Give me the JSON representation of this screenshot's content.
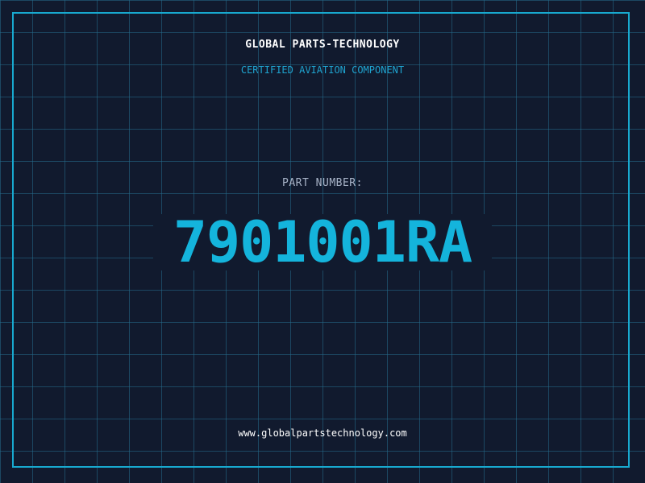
{
  "header": {
    "brand": "GLOBAL PARTS-TECHNOLOGY",
    "tagline": "CERTIFIED AVIATION COMPONENT"
  },
  "main": {
    "label": "PART NUMBER:",
    "part_number": "7901001RA"
  },
  "footer": {
    "url": "www.globalpartstechnology.com"
  },
  "colors": {
    "background": "#111a2e",
    "grid": "#246c8c",
    "accent": "#14b4dc",
    "frame": "#18a9cf"
  }
}
